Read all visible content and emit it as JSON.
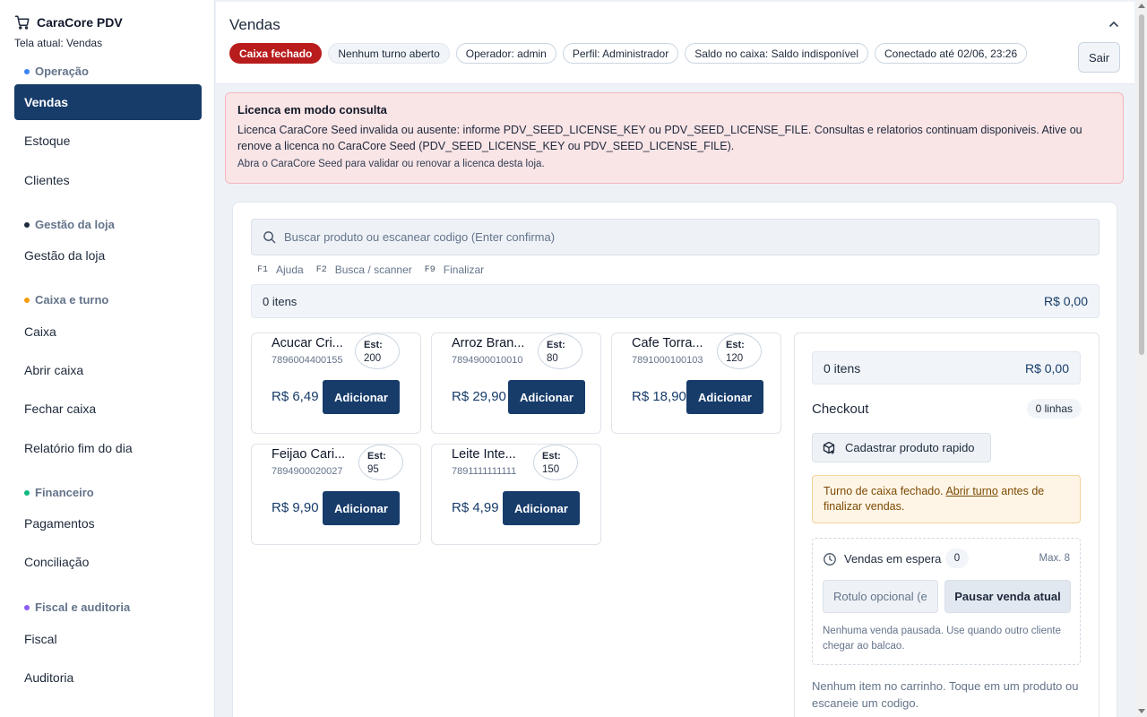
{
  "app": {
    "brand": "CaraCore PDV",
    "current_screen": "Tela atual: Vendas"
  },
  "sidebar": {
    "sections": [
      {
        "label": "Operação",
        "color": "#3b82f6"
      },
      {
        "label": "Gestão da loja",
        "color": "#1e293b"
      },
      {
        "label": "Caixa e turno",
        "color": "#f59e0b"
      },
      {
        "label": "Financeiro",
        "color": "#10b981"
      },
      {
        "label": "Fiscal e auditoria",
        "color": "#8b5cf6"
      }
    ],
    "items": [
      {
        "label": "Vendas",
        "active": true
      },
      {
        "label": "Estoque"
      },
      {
        "label": "Clientes"
      },
      {
        "label": "Gestão da loja"
      },
      {
        "label": "Caixa"
      },
      {
        "label": "Abrir caixa"
      },
      {
        "label": "Fechar caixa"
      },
      {
        "label": "Relatório fim do dia"
      },
      {
        "label": "Pagamentos"
      },
      {
        "label": "Conciliação"
      },
      {
        "label": "Fiscal"
      },
      {
        "label": "Auditoria"
      }
    ]
  },
  "header": {
    "title": "Vendas",
    "chips": [
      "Caixa fechado",
      "Nenhum turno aberto",
      "Operador: admin",
      "Perfil: Administrador",
      "Saldo no caixa: Saldo indisponível",
      "Conectado até 02/06, 23:26"
    ],
    "logout_label": "Sair"
  },
  "license": {
    "title": "Licenca em modo consulta",
    "message": "Licenca CaraCore Seed invalida ou ausente: informe PDV_SEED_LICENSE_KEY ou PDV_SEED_LICENSE_FILE. Consultas e relatorios continuam disponiveis. Ative ou renove a licenca no CaraCore Seed (PDV_SEED_LICENSE_KEY ou PDV_SEED_LICENSE_FILE).",
    "hint": "Abra o CaraCore Seed para validar ou renovar a licenca desta loja."
  },
  "search": {
    "placeholder": "Buscar produto ou escanear codigo (Enter confirma)"
  },
  "shortcuts": [
    {
      "key": "F1",
      "label": "Ajuda"
    },
    {
      "key": "F2",
      "label": "Busca / scanner"
    },
    {
      "key": "F9",
      "label": "Finalizar"
    }
  ],
  "summary": {
    "items": "0 itens",
    "total": "R$ 0,00"
  },
  "products": [
    {
      "name": "Acucar Cri...",
      "code": "7896004400155",
      "stock_label": "Est:",
      "stock": "200",
      "price": "R$ 6,49",
      "add_label": "Adicionar"
    },
    {
      "name": "Arroz Bran...",
      "code": "7894900010010",
      "stock_label": "Est:",
      "stock": "80",
      "price": "R$ 29,90",
      "add_label": "Adicionar"
    },
    {
      "name": "Cafe Torra...",
      "code": "7891000100103",
      "stock_label": "Est:",
      "stock": "120",
      "price": "R$ 18,90",
      "add_label": "Adicionar"
    },
    {
      "name": "Feijao Cari...",
      "code": "7894900020027",
      "stock_label": "Est:",
      "stock": "95",
      "price": "R$ 9,90",
      "add_label": "Adicionar"
    },
    {
      "name": "Leite Inte...",
      "code": "7891111111111",
      "stock_label": "Est:",
      "stock": "150",
      "price": "R$ 4,99",
      "add_label": "Adicionar"
    }
  ],
  "checkout": {
    "items": "0 itens",
    "total": "R$ 0,00",
    "title": "Checkout",
    "lines": "0 linhas",
    "quick_add_label": "Cadastrar produto rapido",
    "warning_before": "Turno de caixa fechado.",
    "warning_link": "Abrir turno",
    "warning_after": "antes de finalizar vendas.",
    "held_title": "Vendas em espera",
    "held_count": "0",
    "held_max": "Max. 8",
    "held_placeholder": "Rotulo opcional (e",
    "pause_label": "Pausar venda atual",
    "held_empty": "Nenhuma venda pausada. Use quando outro cliente chegar ao balcao.",
    "cart_empty": "Nenhum item no carrinho. Toque em um produto ou escaneie um codigo."
  }
}
